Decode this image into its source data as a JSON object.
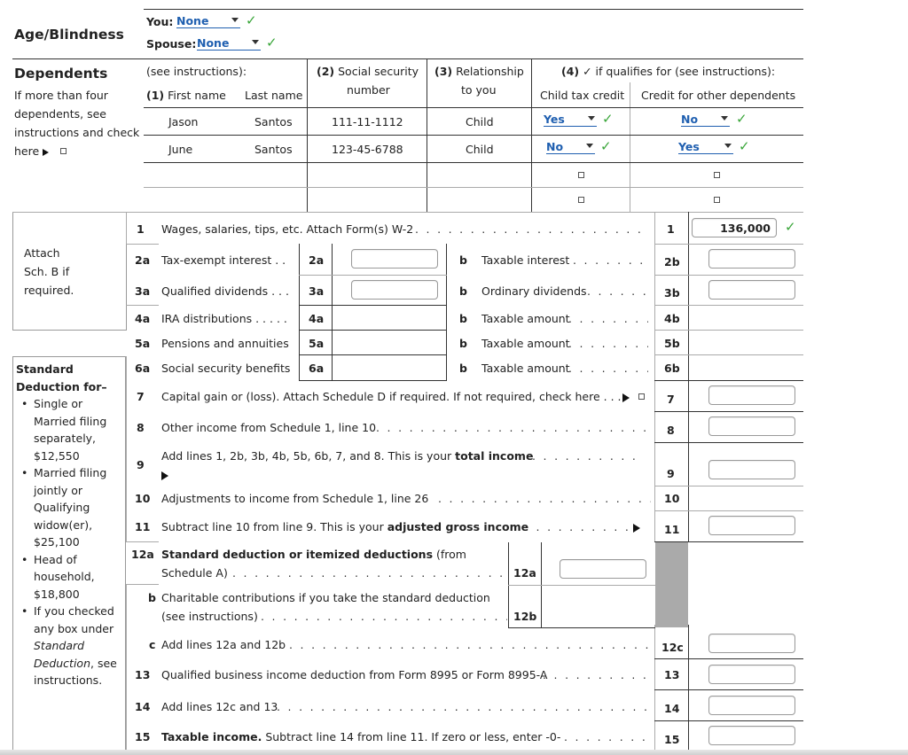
{
  "age_blindness": {
    "label": "Age/Blindness",
    "you_label": "You:",
    "you_value": "None",
    "spouse_label": "Spouse:",
    "spouse_value": "None"
  },
  "dependents": {
    "title": "Dependents",
    "note_lines": [
      "If more than four",
      "dependents, see",
      "instructions and check",
      "here"
    ],
    "columns": {
      "see_instructions": "(see instructions):",
      "col1_num": "(1)",
      "first_name": "First name",
      "last_name": "Last name",
      "col2_num": "(2)",
      "col2_line1": "Social security",
      "col2_line2": "number",
      "col3_num": "(3)",
      "col3_line1": "Relationship",
      "col3_line2": "to you",
      "col4_num": "(4)",
      "col4_text": "✓ if qualifies for (see instructions):",
      "child_tax_credit": "Child tax credit",
      "credit_other": "Credit for other dependents"
    },
    "rows": [
      {
        "first": "Jason",
        "last": "Santos",
        "ssn": "111-11-1112",
        "relationship": "Child",
        "child_tax_credit": "Yes",
        "credit_other": "No"
      },
      {
        "first": "June",
        "last": "Santos",
        "ssn": "123-45-6788",
        "relationship": "Child",
        "child_tax_credit": "No",
        "credit_other": "Yes"
      }
    ]
  },
  "income": {
    "attach_note": [
      "Attach",
      "Sch. B if",
      "required."
    ],
    "line1": {
      "num": "1",
      "label": "Wages, salaries, tips, etc. Attach Form(s) W-2",
      "box": "1",
      "value": "136,000"
    },
    "line2a": {
      "num": "2a",
      "label": "Tax-exempt interest . .",
      "box": "2a",
      "value": ""
    },
    "line2b": {
      "num": "b",
      "label": "Taxable interest",
      "box": "2b",
      "value": ""
    },
    "line3a": {
      "num": "3a",
      "label": "Qualified dividends . . .",
      "box": "3a",
      "value": ""
    },
    "line3b": {
      "num": "b",
      "label": "Ordinary dividends",
      "box": "3b",
      "value": ""
    },
    "line4a": {
      "num": "4a",
      "label": "IRA distributions . . . . .",
      "box": "4a"
    },
    "line4b": {
      "num": "b",
      "label": "Taxable amount",
      "box": "4b"
    },
    "line5a": {
      "num": "5a",
      "label": "Pensions and annuities",
      "box": "5a"
    },
    "line5b": {
      "num": "b",
      "label": "Taxable amount",
      "box": "5b"
    },
    "line6a": {
      "num": "6a",
      "label": "Social security benefits",
      "box": "6a"
    },
    "line6b": {
      "num": "b",
      "label": "Taxable amount",
      "box": "6b"
    },
    "line7": {
      "num": "7",
      "label": "Capital gain or (loss). Attach Schedule D if required. If not required, check here . . .",
      "box": "7",
      "value": ""
    },
    "line8": {
      "num": "8",
      "label": "Other income from Schedule 1, line 10",
      "box": "8",
      "value": ""
    },
    "line9": {
      "num": "9",
      "label_pre": "Add lines 1, 2b, 3b, 4b, 5b, 6b, 7, and 8. This is your ",
      "label_bold": "total income",
      "box": "9",
      "value": ""
    },
    "line10": {
      "num": "10",
      "label": "Adjustments to income from Schedule 1, line 26",
      "box": "10"
    },
    "line11": {
      "num": "11",
      "label_pre": "Subtract line 10 from line 9. This is your ",
      "label_bold": "adjusted gross income",
      "box": "11",
      "value": ""
    }
  },
  "standard_deduction": {
    "title_line1": "Standard",
    "title_line2": "Deduction for–",
    "items": [
      [
        "Single or",
        "Married filing",
        "separately,",
        "$12,550"
      ],
      [
        "Married filing",
        "jointly or",
        "Qualifying",
        "widow(er),",
        "$25,100"
      ],
      [
        "Head of",
        "household,",
        "$18,800"
      ],
      [
        "If you checked",
        "any box under"
      ]
    ],
    "item4_italic1": "Standard",
    "item4_italic2": "Deduction",
    "item4_rest": ", see",
    "item4_last": "instructions."
  },
  "deductions": {
    "line12a": {
      "num": "12a",
      "label_bold": "Standard deduction or itemized deductions",
      "label_rest": " (from",
      "label_line2": "Schedule A)",
      "box": "12a",
      "value": ""
    },
    "line12b": {
      "num": "b",
      "label_line1": "Charitable contributions if you take the standard deduction",
      "label_line2": "(see instructions)",
      "box": "12b"
    },
    "line12c": {
      "num": "c",
      "label": "Add lines 12a and 12b",
      "box": "12c",
      "value": ""
    },
    "line13": {
      "num": "13",
      "label": "Qualified business income deduction from Form 8995 or Form 8995-A",
      "box": "13",
      "value": ""
    },
    "line14": {
      "num": "14",
      "label": "Add lines 12c and 13",
      "box": "14",
      "value": ""
    },
    "line15": {
      "num": "15",
      "label_bold": "Taxable income.",
      "label_rest": " Subtract line 14 from line 11. If zero or less, enter -0-",
      "box": "15",
      "value": ""
    }
  },
  "colors": {
    "select_blue": "#1f5fb0",
    "check_green": "#3aa63a",
    "shaded_gray": "#aaaaaa"
  }
}
